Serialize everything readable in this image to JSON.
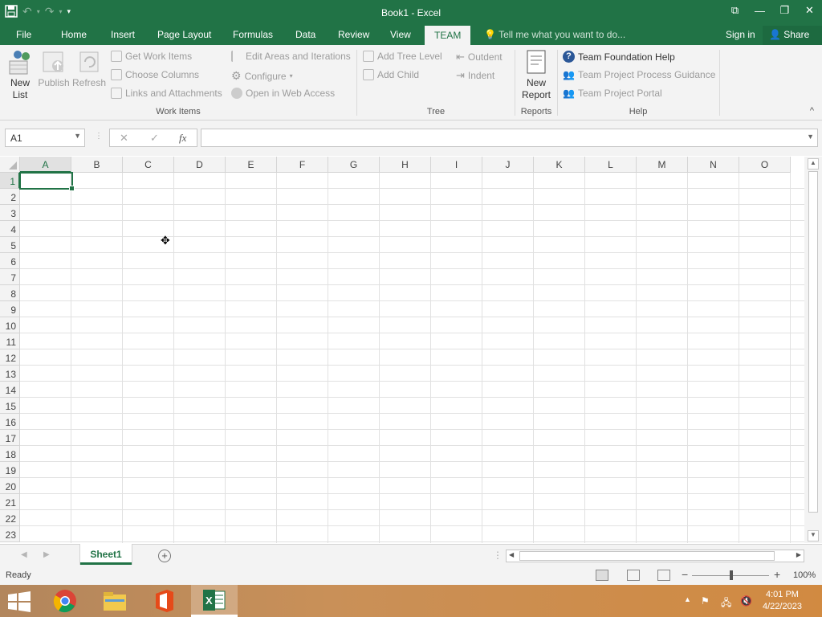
{
  "window": {
    "title": "Book1 - Excel",
    "controls": {
      "ribbon_display": "⧉",
      "minimize": "—",
      "restore": "❐",
      "close": "✕"
    }
  },
  "quick_access": {
    "save": "💾",
    "undo": "↶",
    "redo": "↷",
    "customize": "▾"
  },
  "tabs": [
    "File",
    "Home",
    "Insert",
    "Page Layout",
    "Formulas",
    "Data",
    "Review",
    "View",
    "TEAM"
  ],
  "active_tab": "TEAM",
  "tell_me": "Tell me what you want to do...",
  "sign_in": "Sign in",
  "share": "Share",
  "ribbon": {
    "new_list": "New List",
    "new_list_l1": "New",
    "new_list_l2": "List",
    "publish": "Publish",
    "refresh": "Refresh",
    "get_work_items": "Get Work Items",
    "choose_columns": "Choose Columns",
    "links_attachments": "Links and Attachments",
    "edit_areas": "Edit Areas and Iterations",
    "configure": "Configure",
    "open_web_access": "Open in Web Access",
    "work_items_group": "Work Items",
    "add_tree_level": "Add Tree Level",
    "add_child": "Add Child",
    "outdent": "Outdent",
    "indent": "Indent",
    "tree_group": "Tree",
    "new_report_l1": "New",
    "new_report_l2": "Report",
    "reports_group": "Reports",
    "tf_help": "Team Foundation Help",
    "process_guidance": "Team Project Process Guidance",
    "project_portal": "Team Project Portal",
    "help_group": "Help",
    "collapse": "^"
  },
  "formula_bar": {
    "name_box": "A1",
    "cancel": "✕",
    "enter": "✓",
    "fx": "fx",
    "value": ""
  },
  "grid": {
    "columns": [
      "A",
      "B",
      "C",
      "D",
      "E",
      "F",
      "G",
      "H",
      "I",
      "J",
      "K",
      "L",
      "M",
      "N",
      "O"
    ],
    "rows": [
      "1",
      "2",
      "3",
      "4",
      "5",
      "6",
      "7",
      "8",
      "9",
      "10",
      "11",
      "12",
      "13",
      "14",
      "15",
      "16",
      "17",
      "18",
      "19",
      "20",
      "21",
      "22",
      "23"
    ],
    "active_cell": "A1"
  },
  "sheets": [
    "Sheet1"
  ],
  "add_sheet": "+",
  "status": {
    "ready": "Ready",
    "zoom_minus": "−",
    "zoom_plus": "+",
    "zoom": "100%"
  },
  "taskbar": {
    "apps": [
      "chrome-icon",
      "file-explorer-icon",
      "office-icon",
      "excel-icon"
    ],
    "time": "4:01 PM",
    "date": "4/22/2023",
    "colors": {
      "accent": "#217346"
    }
  }
}
